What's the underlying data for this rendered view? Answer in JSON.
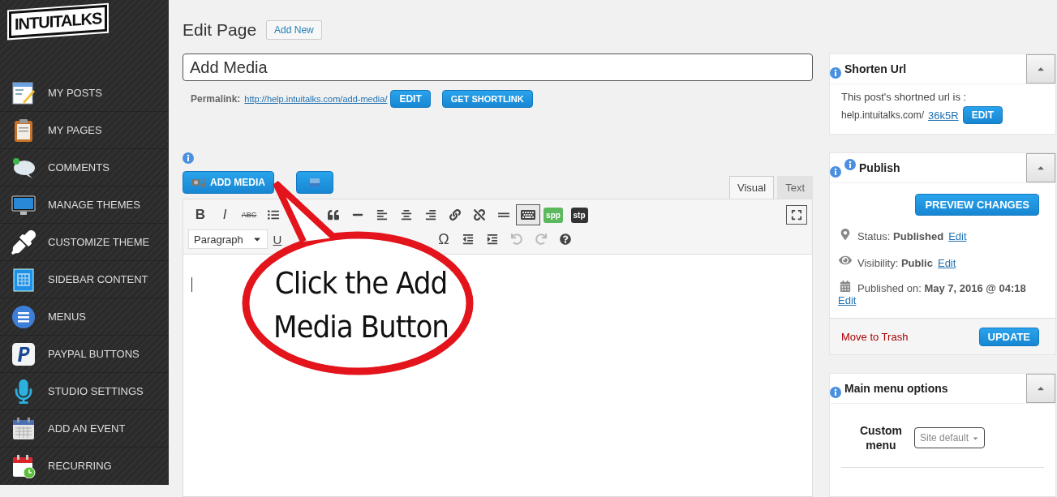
{
  "logo": {
    "text": "INTUITALKS"
  },
  "sidebar": {
    "items": [
      {
        "label": "MY POSTS",
        "kind": "posts"
      },
      {
        "label": "MY PAGES",
        "kind": "pages"
      },
      {
        "label": "COMMENTS",
        "kind": "comments"
      },
      {
        "label": "MANAGE THEMES",
        "kind": "themes"
      },
      {
        "label": "CUSTOMIZE THEME",
        "kind": "customize"
      },
      {
        "label": "SIDEBAR CONTENT",
        "kind": "sidebar"
      },
      {
        "label": "MENUS",
        "kind": "menus"
      },
      {
        "label": "PAYPAL BUTTONS",
        "kind": "paypal"
      },
      {
        "label": "STUDIO SETTINGS",
        "kind": "studio"
      },
      {
        "label": "ADD AN EVENT",
        "kind": "event"
      },
      {
        "label": "RECURRING",
        "kind": "recurring"
      }
    ]
  },
  "header": {
    "title": "Edit Page",
    "add_new": "Add New"
  },
  "title_field": {
    "value": "Add Media"
  },
  "permalink": {
    "label": "Permalink:",
    "url": "http://help.intuitalks.com/add-media/",
    "edit": "EDIT",
    "shortlink": "GET SHORTLINK"
  },
  "editor": {
    "add_media": "ADD MEDIA",
    "tabs": [
      {
        "label": "Visual",
        "selected": true
      },
      {
        "label": "Text",
        "selected": false
      }
    ],
    "toolbar_row_1_left": [
      {
        "kind": "bold",
        "text": "B",
        "pressed": false
      },
      {
        "kind": "italic",
        "text": "I",
        "pressed": false
      },
      {
        "kind": "strike",
        "text": "ABC",
        "pressed": false
      },
      {
        "kind": "bullets",
        "pressed": false
      }
    ],
    "toolbar_row_1_right": [
      {
        "kind": "quote",
        "pressed": false
      },
      {
        "kind": "hr",
        "pressed": false
      },
      {
        "kind": "align-left",
        "pressed": false
      },
      {
        "kind": "align-center",
        "pressed": false
      },
      {
        "kind": "align-right",
        "pressed": false
      },
      {
        "kind": "link",
        "pressed": false
      },
      {
        "kind": "unlink",
        "pressed": false
      },
      {
        "kind": "more",
        "pressed": false
      },
      {
        "kind": "toggle",
        "pressed": true
      },
      {
        "kind": "spp",
        "text": "spp",
        "pressed": false
      },
      {
        "kind": "stp",
        "text": "stp",
        "pressed": false
      }
    ],
    "format_select": "Paragraph",
    "toolbar_row_2_left": [
      {
        "kind": "underline",
        "text": "U",
        "disabled": false
      }
    ],
    "toolbar_row_2_right": [
      {
        "kind": "omega",
        "text": "Ω",
        "disabled": false
      },
      {
        "kind": "outdent",
        "disabled": false
      },
      {
        "kind": "indent",
        "disabled": false
      },
      {
        "kind": "undo",
        "disabled": true
      },
      {
        "kind": "redo",
        "disabled": true
      },
      {
        "kind": "help",
        "disabled": false
      }
    ]
  },
  "callout": {
    "text": "Click the Add Media Button"
  },
  "shorten_url": {
    "title": "Shorten Url",
    "intro": "This post's shortned url is :",
    "domain": "help.intuitalks.com/",
    "code": "36k5R",
    "edit": "EDIT"
  },
  "publish": {
    "title": "Publish",
    "preview": "PREVIEW CHANGES",
    "rows": [
      {
        "kind": "status",
        "text": "Status: **Published**",
        "link": "Edit"
      },
      {
        "kind": "visibility",
        "text": "Visibility: **Public**",
        "link": "Edit"
      },
      {
        "kind": "date",
        "text": "Published on: **May 7, 2016 @ 04:18**",
        "link": "Edit"
      }
    ],
    "trash": "Move to Trash",
    "update": "UPDATE"
  },
  "main_menu": {
    "title": "Main menu options",
    "label": "Custom menu",
    "select": "Site default"
  }
}
